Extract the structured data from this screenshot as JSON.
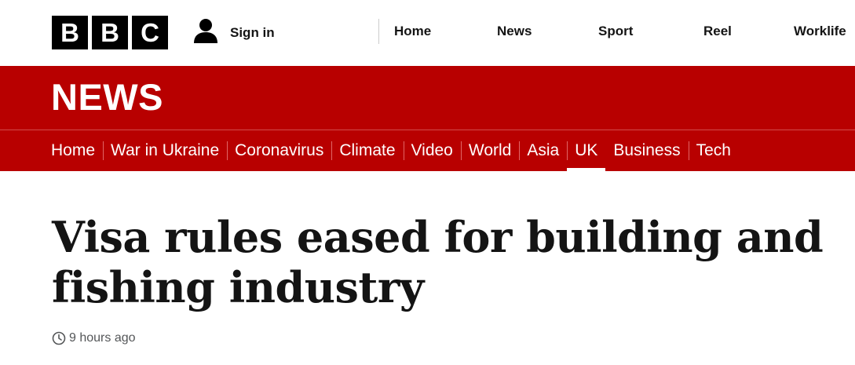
{
  "brand": {
    "logo_letters": [
      "B",
      "B",
      "C"
    ]
  },
  "account": {
    "signin_label": "Sign in",
    "icon": "user-icon"
  },
  "global_nav": {
    "items": [
      {
        "label": "Home"
      },
      {
        "label": "News"
      },
      {
        "label": "Sport"
      },
      {
        "label": "Reel"
      },
      {
        "label": "Worklife"
      }
    ]
  },
  "masthead": {
    "title": "NEWS",
    "background": "#b80000"
  },
  "section_nav": {
    "items": [
      {
        "label": "Home",
        "active": false
      },
      {
        "label": "War in Ukraine",
        "active": false
      },
      {
        "label": "Coronavirus",
        "active": false
      },
      {
        "label": "Climate",
        "active": false
      },
      {
        "label": "Video",
        "active": false
      },
      {
        "label": "World",
        "active": false
      },
      {
        "label": "Asia",
        "active": false
      },
      {
        "label": "UK",
        "active": true
      },
      {
        "label": "Business",
        "active": false
      },
      {
        "label": "Tech",
        "active": false
      }
    ]
  },
  "article": {
    "headline": "Visa rules eased for building and fishing industry",
    "published": "9 hours ago",
    "time_icon": "clock-icon"
  }
}
